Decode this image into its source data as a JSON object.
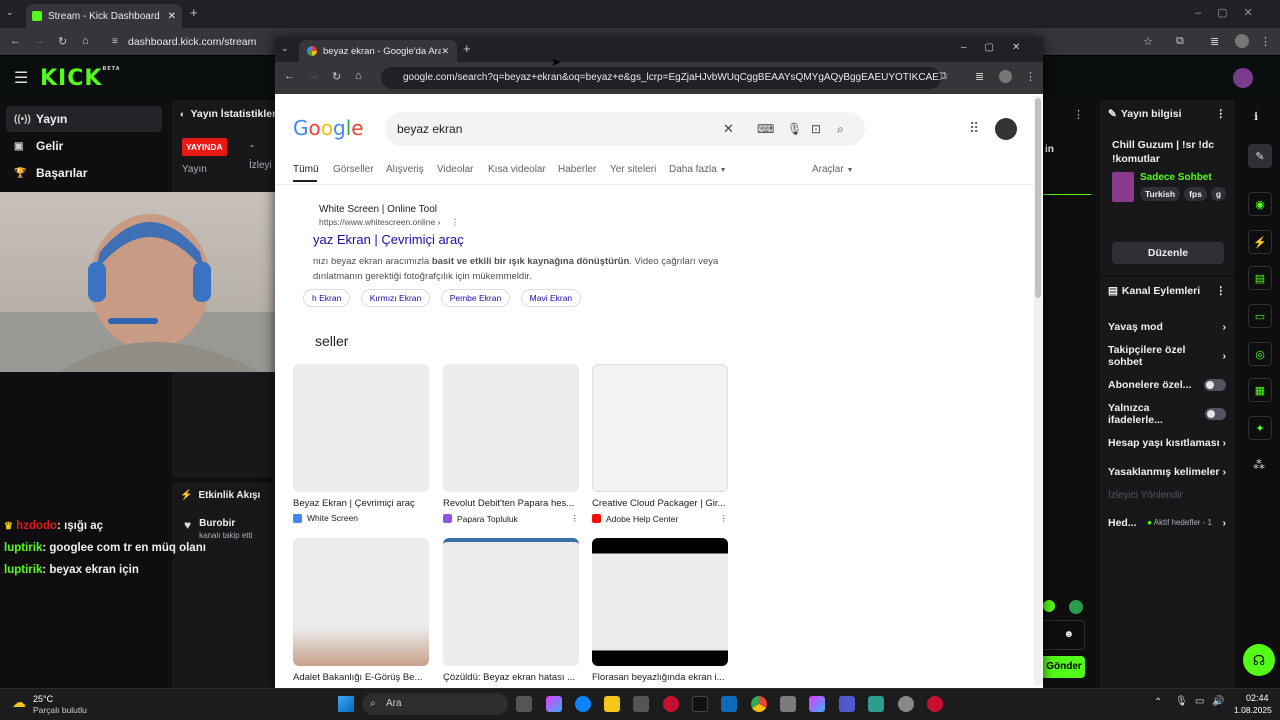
{
  "outer_browser": {
    "tab_title": "Stream - Kick Dashboard",
    "url": "dashboard.kick.com/stream"
  },
  "kick": {
    "logo": "KICK",
    "logo_badge": "BETA",
    "sidebar": [
      {
        "label": "Yayın",
        "icon": "broadcast-icon"
      },
      {
        "label": "Gelir",
        "icon": "revenue-icon"
      },
      {
        "label": "Başarılar",
        "icon": "trophy-icon"
      }
    ],
    "stats": {
      "title": "Yayın İstatistikleri",
      "live_badge": "YAYINDA",
      "dash": "-",
      "label_stream": "Yayın",
      "label_viewers": "İzleyi"
    },
    "events": {
      "title": "Etkinlik Akışı",
      "item_name": "Burobir",
      "item_desc": "kanalı takip etti"
    },
    "chat": [
      {
        "user": "hzdodo",
        "text": ": ışığı aç",
        "color": "#e91916"
      },
      {
        "user": "luptirik",
        "text": ": googlee com tr en müq olanı",
        "color": "#53fc18"
      },
      {
        "user": "luptirik",
        "text": ": beyax ekran için",
        "color": "#53fc18"
      }
    ],
    "mid_text": "in",
    "send_button": "Gönder",
    "stream_info": {
      "title": "Yayın bilgisi",
      "stream_title": "Chill Guzum | !sr !dc !komutlar",
      "category": "Sadece Sohbet",
      "tags": [
        "Turkish",
        "fps",
        "g"
      ],
      "edit_button": "Düzenle"
    },
    "channel_actions": {
      "title": "Kanal Eylemleri",
      "items": [
        {
          "label": "Yavaş mod",
          "type": "arrow"
        },
        {
          "label": "Takipçilere özel sohbet",
          "type": "arrow"
        },
        {
          "label": "Abonelere özel...",
          "type": "toggle"
        },
        {
          "label": "Yalnızca ifadelerle...",
          "type": "toggle"
        },
        {
          "label": "Hesap yaşı kısıtlaması",
          "type": "arrow"
        },
        {
          "label": "Yasaklanmış kelimeler",
          "type": "arrow"
        }
      ],
      "viewer_redirect": "İzleyici Yönlendir",
      "goals_label": "Hed...",
      "goals_value": "Aktif hedefler - 1"
    }
  },
  "inner_browser": {
    "tab_title": "beyaz ekran - Google'da Ara",
    "url": "google.com/search?q=beyaz+ekran&oq=beyaz+e&gs_lcrp=EgZjaHJvbWUqCggBEAAYsQMYgAQyBggEAEUYOTIKCAE..."
  },
  "google": {
    "logo": "Google",
    "query": "beyaz ekran",
    "tabs": [
      "Tümü",
      "Görseller",
      "Alışveriş",
      "Videolar",
      "Kısa videolar",
      "Haberler",
      "Yer siteleri",
      "Daha fazla",
      "Araçlar"
    ],
    "result": {
      "site": "White Screen | Online Tool",
      "url": "https://www.whitescreen.online ›",
      "title": "yaz Ekran | Çevrimiçi araç",
      "snippet_1": "nızı beyaz ekran aracımızla ",
      "snippet_bold": "basit ve etkili bir ışık kaynağına dönüştürün",
      "snippet_2": ". Video çağrıları veya",
      "snippet_3": "dınlatmanın gerektiği fotoğrafçılık için mükemmeldir.",
      "pills": [
        "h Ekran",
        "Kırmızı Ekran",
        "Pembe Ekran",
        "Mavi Ekran"
      ]
    },
    "images_heading": "seller",
    "images": [
      {
        "caption": "Beyaz Ekran | Çevrimiçi araç",
        "source": "White Screen",
        "fav": "#4285f4"
      },
      {
        "caption": "Revolut Debit'ten Papara hes...",
        "source": "Papara Topluluk",
        "fav": "#8a56e2"
      },
      {
        "caption": "Creative Cloud Packager | Gir...",
        "source": "Adobe Help Center",
        "fav": "#fa0f00"
      },
      {
        "caption": "Adalet Bakanlığı E-Görüş Be...",
        "source": "",
        "fav": "#888888"
      },
      {
        "caption": "Çözüldü: Beyaz ekran hatası ...",
        "source": "",
        "fav": "#888888"
      },
      {
        "caption": "Florasan beyazlığında ekran i...",
        "source": "",
        "fav": "#888888"
      }
    ]
  },
  "taskbar": {
    "weather_temp": "25°C",
    "weather_desc": "Parçalı bulutlu",
    "search_placeholder": "Ara",
    "time": "02:44",
    "date": "1.08.2025"
  }
}
